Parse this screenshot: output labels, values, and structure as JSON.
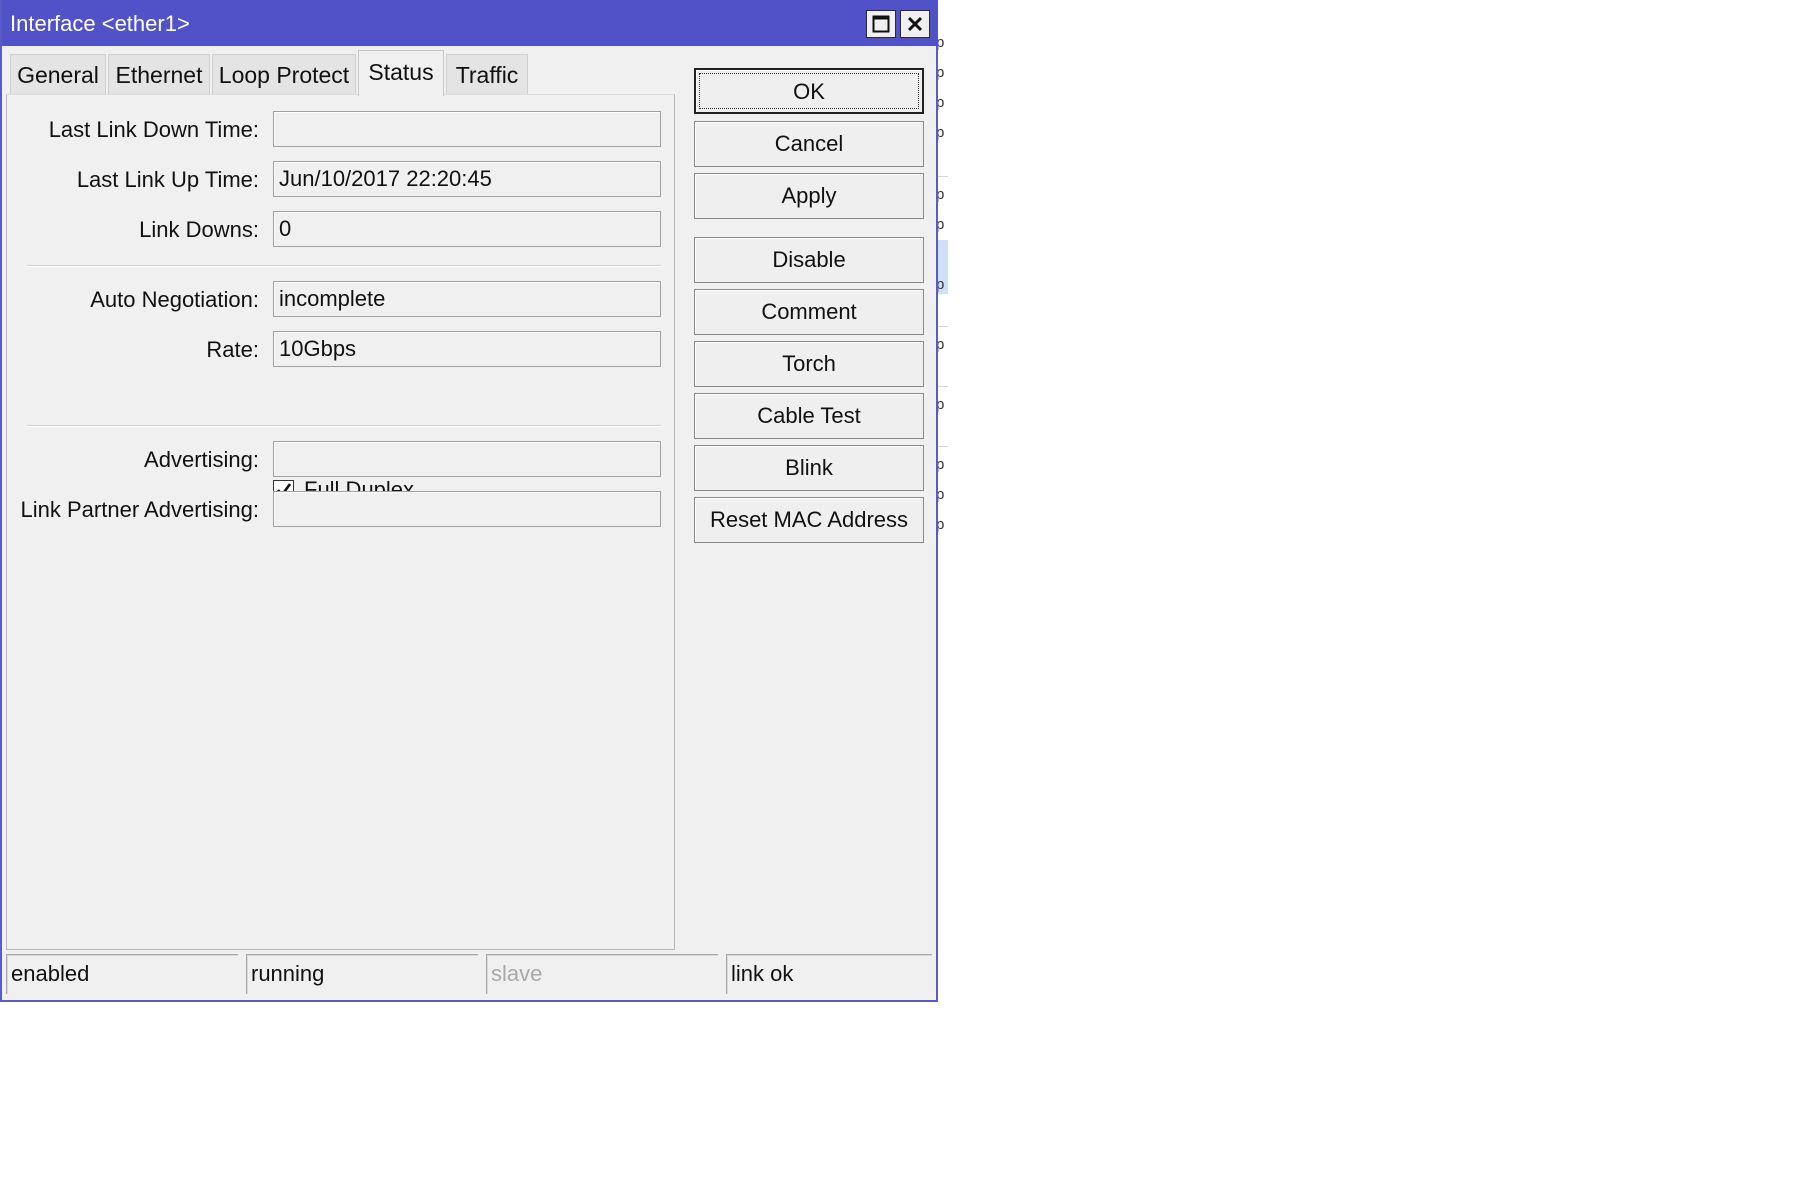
{
  "window": {
    "title": "Interface <ether1>"
  },
  "tabs": [
    {
      "label": "General"
    },
    {
      "label": "Ethernet"
    },
    {
      "label": "Loop Protect"
    },
    {
      "label": "Status"
    },
    {
      "label": "Traffic"
    }
  ],
  "active_tab": "Status",
  "status_tab": {
    "last_link_down_time": {
      "label": "Last Link Down Time:",
      "value": ""
    },
    "last_link_up_time": {
      "label": "Last Link Up Time:",
      "value": "Jun/10/2017 22:20:45"
    },
    "link_downs": {
      "label": "Link Downs:",
      "value": "0"
    },
    "auto_negotiation": {
      "label": "Auto Negotiation:",
      "value": "incomplete"
    },
    "rate": {
      "label": "Rate:",
      "value": "10Gbps"
    },
    "full_duplex": {
      "label": "Full Duplex",
      "checked": true
    },
    "advertising": {
      "label": "Advertising:",
      "value": ""
    },
    "link_partner_advertising": {
      "label": "Link Partner Advertising:",
      "value": ""
    }
  },
  "buttons": {
    "ok": "OK",
    "cancel": "Cancel",
    "apply": "Apply",
    "disable": "Disable",
    "comment": "Comment",
    "torch": "Torch",
    "cable_test": "Cable Test",
    "blink": "Blink",
    "reset_mac": "Reset MAC Address"
  },
  "status_bar": [
    {
      "text": "enabled",
      "dimmed": false
    },
    {
      "text": "running",
      "dimmed": false
    },
    {
      "text": "slave",
      "dimmed": true
    },
    {
      "text": "link ok",
      "dimmed": false
    }
  ],
  "background_window": {
    "row_glyph": "p"
  },
  "colors": {
    "titlebar": "#5252c8",
    "dialog_bg": "#f0f0f0",
    "selected_row": "#cfe0f6"
  },
  "icons": {
    "maximize": "maximize-icon",
    "close": "close-icon",
    "check": "check-icon"
  }
}
